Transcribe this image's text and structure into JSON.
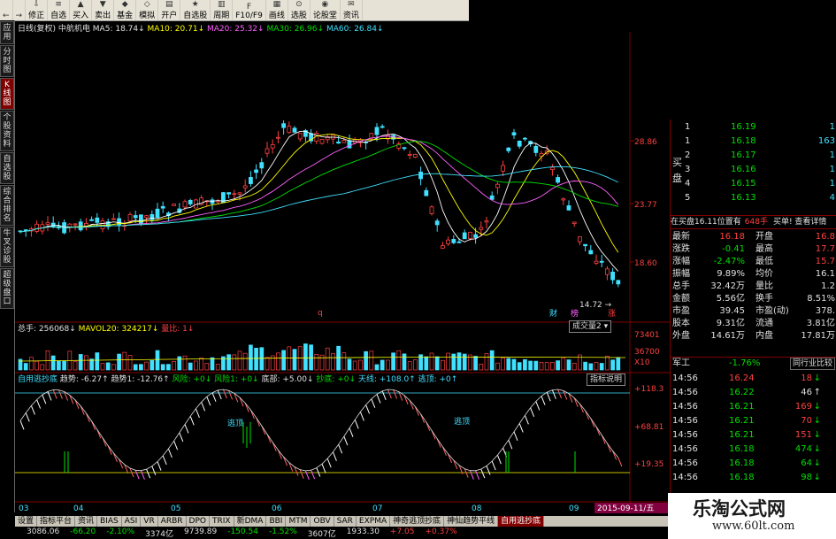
{
  "toolbar": [
    {
      "icon": "←",
      "label": ""
    },
    {
      "icon": "→",
      "label": ""
    },
    {
      "icon": "⇩",
      "label": "修正"
    },
    {
      "icon": "≡",
      "label": "自选"
    },
    {
      "icon": "▲",
      "label": "买入"
    },
    {
      "icon": "▼",
      "label": "卖出"
    },
    {
      "icon": "◆",
      "label": "基金"
    },
    {
      "icon": "◇",
      "label": "模拟"
    },
    {
      "icon": "▤",
      "label": "开户"
    },
    {
      "icon": "★",
      "label": "自选股"
    },
    {
      "icon": "▥",
      "label": "周期"
    },
    {
      "icon": "F",
      "label": "F10/F9"
    },
    {
      "icon": "▦",
      "label": "画线"
    },
    {
      "icon": "⊙",
      "label": "选股"
    },
    {
      "icon": "◉",
      "label": "论股堂"
    },
    {
      "icon": "✉",
      "label": "资讯"
    }
  ],
  "left_tabs": [
    "应用",
    "分时图",
    "K线图",
    "个股资料",
    "自选股",
    "综合排名",
    "牛叉诊股",
    "超级盘口"
  ],
  "ma_header": {
    "title": "日线(复权)",
    "stock": "中航机电",
    "ma5": "MA5: 18.74",
    "ma10": "MA10: 20.71",
    "ma20": "MA20: 25.32",
    "ma30": "MA30: 26.96",
    "ma60": "MA60: 26.84"
  },
  "price_axis": [
    "28.86",
    "23.77",
    "18.60"
  ],
  "low_label": "14.72",
  "chart_markers": [
    "q",
    "财",
    "榜",
    "涨"
  ],
  "vol_header": {
    "total": "总手: 256068",
    "mavol": "MAVOL20: 324217",
    "ratio": "量比: 1"
  },
  "vol_axis": [
    "73401",
    "36700",
    "X10"
  ],
  "vol_button": "成交量2",
  "ind_header": {
    "name": "自用逃抄底",
    "trend": "趋势: -6.27",
    "trend1": "趋势1: -12.76",
    "risk": "风险: +0",
    "risk1": "风险1: +0",
    "bottom": "底部: +5.00",
    "buy": "抄底: +0",
    "sky": "天线: +108.0",
    "escape": "逃顶: +0"
  },
  "ind_button": "指标说明",
  "ind_axis": [
    "+118.3",
    "+68.81",
    "+19.35"
  ],
  "ind_labels": [
    "逃顶",
    "逃顶"
  ],
  "x_axis": [
    "03",
    "04",
    "05",
    "06",
    "07",
    "08",
    "09"
  ],
  "date_label": "2015-09-11/五",
  "rpanel": {
    "asks": [
      {
        "n": "1",
        "p": "16.19",
        "v": "1"
      },
      {
        "n": "1",
        "p": "16.18",
        "v": "163"
      },
      {
        "n": "2",
        "p": "16.17",
        "v": "1"
      },
      {
        "n": "3",
        "p": "16.16",
        "v": "1"
      },
      {
        "n": "4",
        "p": "16.15",
        "v": "1"
      },
      {
        "n": "5",
        "p": "16.13",
        "v": "4"
      }
    ],
    "buy_label": "买盘",
    "notice": "在买盘16.11位置有",
    "notice2": "648手",
    "notice3": "买单! 查看详情",
    "stats": [
      [
        "最新",
        "16.18",
        "开盘",
        "16.8"
      ],
      [
        "涨跌",
        "-0.41",
        "最高",
        "17.7"
      ],
      [
        "涨幅",
        "-2.47%",
        "最低",
        "15.7"
      ],
      [
        "振幅",
        "9.89%",
        "均价",
        "16.1"
      ],
      [
        "总手",
        "32.42万",
        "量比",
        "1.2"
      ],
      [
        "金额",
        "5.56亿",
        "换手",
        "8.51%"
      ],
      [
        "市盈",
        "39.45",
        "市盈(动)",
        "378."
      ],
      [
        "股本",
        "9.31亿",
        "流通",
        "3.81亿"
      ],
      [
        "外盘",
        "14.61万",
        "内盘",
        "17.81万"
      ]
    ],
    "industry": {
      "name": "军工",
      "chg": "-1.76%",
      "btn": "同行业比较"
    },
    "ticks": [
      [
        "14:56",
        "16.24",
        "18",
        "↓"
      ],
      [
        "14:56",
        "16.22",
        "46",
        "↑"
      ],
      [
        "14:56",
        "16.21",
        "169",
        "↓"
      ],
      [
        "14:56",
        "16.21",
        "70",
        "↓"
      ],
      [
        "14:56",
        "16.21",
        "151",
        "↓"
      ],
      [
        "14:56",
        "16.18",
        "474",
        "↓"
      ],
      [
        "14:56",
        "16.18",
        "64",
        "↓"
      ],
      [
        "14:56",
        "16.18",
        "98",
        "↓"
      ]
    ]
  },
  "bottom_tabs": [
    "设置",
    "指标平台",
    "资讯",
    "BIAS",
    "ASI",
    "VR",
    "ARBR",
    "DPO",
    "TRIX",
    "新DMA",
    "BBI",
    "MTM",
    "OBV",
    "SAR",
    "EXPMA",
    "神奇逃顶抄底",
    "神仙趋势平线",
    "自用逃抄底"
  ],
  "status": [
    "3086.06",
    "-66.20",
    "-2.10%",
    "3374亿",
    "9739.89",
    "-150.54",
    "-1.52%",
    "3607亿",
    "1933.30",
    "+7.05",
    "+0.37%"
  ],
  "watermark": {
    "title": "乐淘公式网",
    "url": "www.60lt.com"
  },
  "colors": {
    "up": "#ff4040",
    "down": "#40e0ff",
    "ma5": "#ffffff",
    "ma10": "#ffff00",
    "ma20": "#ff60ff",
    "ma30": "#00e000",
    "ma60": "#40e0ff"
  }
}
